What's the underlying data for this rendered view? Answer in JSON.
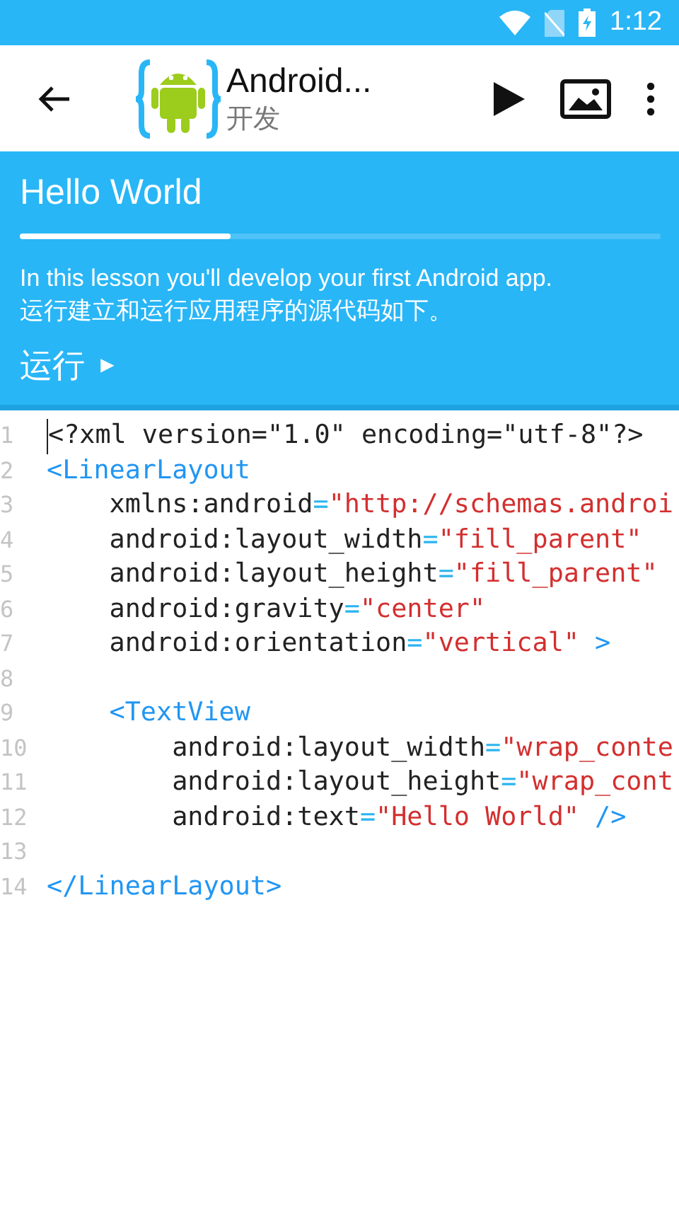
{
  "status_bar": {
    "time": "1:12"
  },
  "app_bar": {
    "title": "Android...",
    "subtitle": "开发"
  },
  "lesson": {
    "title": "Hello World",
    "progress": {
      "level": 0.33
    },
    "description": [
      "In this lesson you'll develop your first Android app.",
      "运行建立和运行应用程序的源代码如下。"
    ],
    "run_label": "运行",
    "run_arrow": "►"
  },
  "editor": {
    "lines": [
      {
        "number": "1",
        "tokens": [
          {
            "kind": "plain",
            "text": "<?xml version=\"1.0\" encoding=\"utf-8\"?>"
          }
        ]
      },
      {
        "number": "2",
        "tokens": [
          {
            "kind": "tag",
            "text": "<LinearLayout"
          }
        ]
      },
      {
        "number": "3",
        "tokens": [
          {
            "kind": "plain",
            "text": "    xmlns:android"
          },
          {
            "kind": "punct",
            "text": "="
          },
          {
            "kind": "string",
            "text": "\"http://schemas.androi"
          }
        ]
      },
      {
        "number": "4",
        "tokens": [
          {
            "kind": "plain",
            "text": "    android:layout_width"
          },
          {
            "kind": "punct",
            "text": "="
          },
          {
            "kind": "string",
            "text": "\"fill_parent\""
          }
        ]
      },
      {
        "number": "5",
        "tokens": [
          {
            "kind": "plain",
            "text": "    android:layout_height"
          },
          {
            "kind": "punct",
            "text": "="
          },
          {
            "kind": "string",
            "text": "\"fill_parent\""
          }
        ]
      },
      {
        "number": "6",
        "tokens": [
          {
            "kind": "plain",
            "text": "    android:gravity"
          },
          {
            "kind": "punct",
            "text": "="
          },
          {
            "kind": "string",
            "text": "\"center\""
          }
        ]
      },
      {
        "number": "7",
        "tokens": [
          {
            "kind": "plain",
            "text": "    android:orientation"
          },
          {
            "kind": "punct",
            "text": "="
          },
          {
            "kind": "string",
            "text": "\"vertical\""
          },
          {
            "kind": "tag",
            "text": " >"
          }
        ]
      },
      {
        "number": "8"
      },
      {
        "number": "9",
        "tokens": [
          {
            "kind": "tag",
            "text": "    <TextView"
          }
        ]
      },
      {
        "number": "10",
        "tokens": [
          {
            "kind": "plain",
            "text": "        android:layout_width"
          },
          {
            "kind": "punct",
            "text": "="
          },
          {
            "kind": "string",
            "text": "\"wrap_conte"
          }
        ]
      },
      {
        "number": "11",
        "tokens": [
          {
            "kind": "plain",
            "text": "        android:layout_height"
          },
          {
            "kind": "punct",
            "text": "="
          },
          {
            "kind": "string",
            "text": "\"wrap_cont"
          }
        ]
      },
      {
        "number": "12",
        "tokens": [
          {
            "kind": "plain",
            "text": "        android:text"
          },
          {
            "kind": "punct",
            "text": "="
          },
          {
            "kind": "string",
            "text": "\"Hello World\""
          },
          {
            "kind": "tag",
            "text": " />"
          }
        ]
      },
      {
        "number": "13"
      },
      {
        "number": "14",
        "tokens": [
          {
            "kind": "tag",
            "text": "</LinearLayout>"
          }
        ]
      }
    ]
  }
}
